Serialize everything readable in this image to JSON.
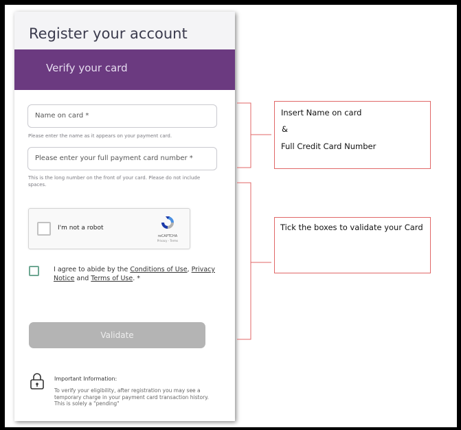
{
  "register": {
    "title": "Register your account"
  },
  "banner": {
    "title": "Verify your card"
  },
  "card_name": {
    "placeholder": "Name on card *",
    "hint": "Please enter the name as it appears on your payment card."
  },
  "card_number": {
    "placeholder": "Please enter your full payment card number *",
    "hint": "This is the long number on the front of your card. Please do not include spaces."
  },
  "captcha": {
    "label": "I'm not a robot",
    "brand": "reCAPTCHA",
    "terms": "Privacy - Terms"
  },
  "agreement": {
    "text_1": "I agree to abide by the ",
    "conditions": "Conditions of Use",
    "text_2": ", ",
    "privacy": "Privacy Notice",
    "text_3": " and ",
    "terms": "Terms of Use",
    "text_4": ". *"
  },
  "validate_button": {
    "label": "Validate"
  },
  "info": {
    "title": "Important Information:",
    "body": "To verify your eligibility, after registration you may see a temporary charge in your payment card transaction history. This is solely a \"pending\""
  },
  "callout_card": {
    "line1": "Insert Name on card",
    "line2": "&",
    "line3": "Full Credit Card Number"
  },
  "callout_validate": {
    "text": "Tick the boxes to validate your Card"
  },
  "colors": {
    "banner": "#6b3a80",
    "callout_border": "#e06666",
    "button_disabled": "#b4b4b4",
    "agree_checkbox": "#6ea792"
  }
}
